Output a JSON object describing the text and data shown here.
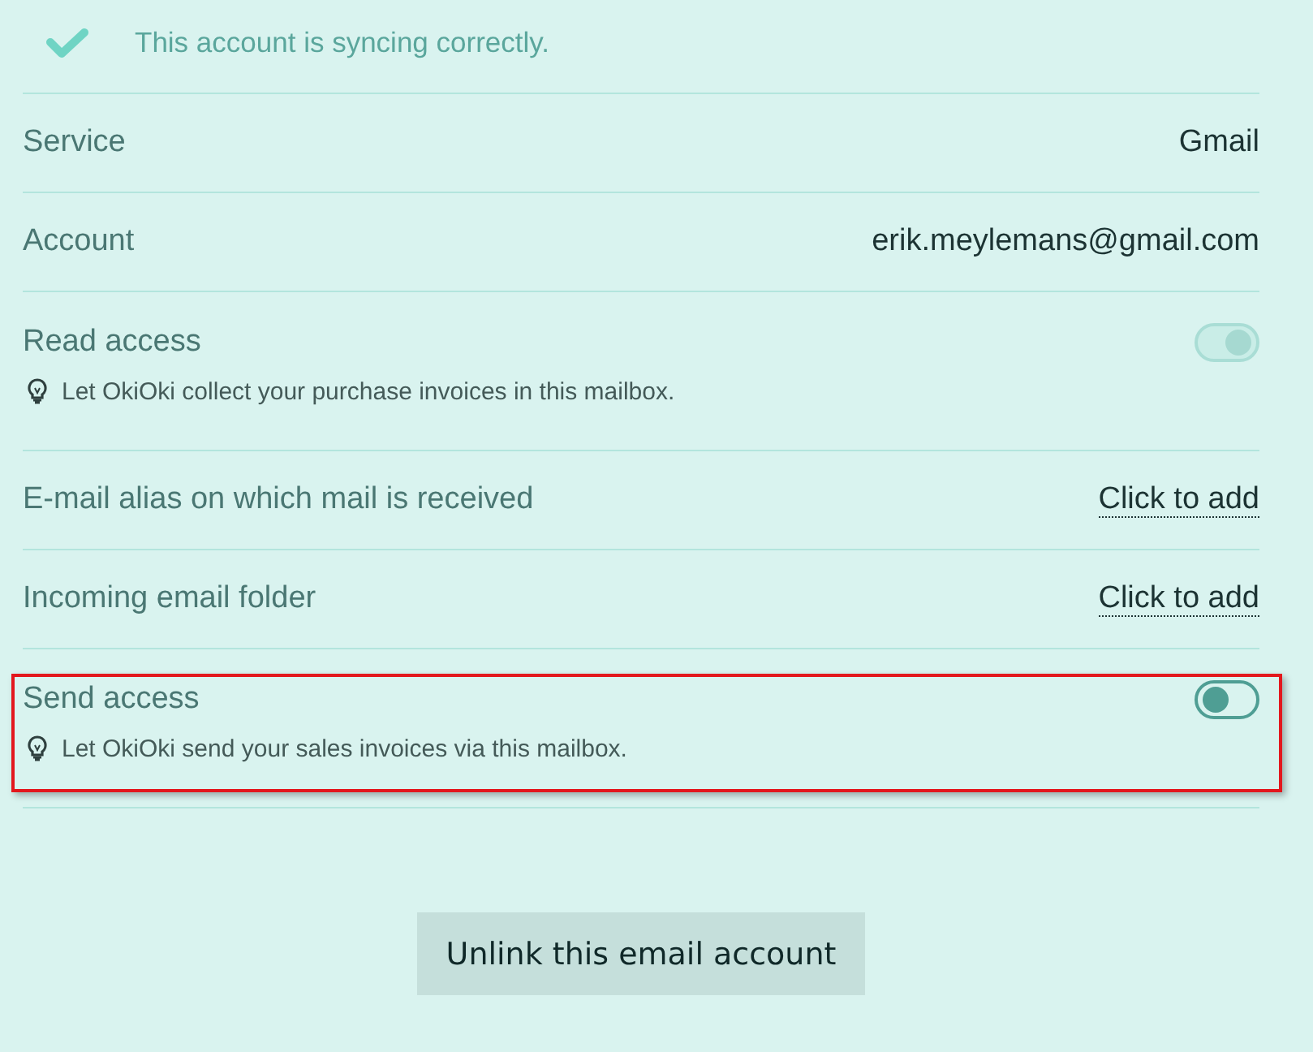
{
  "status": {
    "text": "This account is syncing correctly."
  },
  "rows": [
    {
      "kind": "value",
      "label": "Service",
      "value": "Gmail",
      "highlighted": false
    },
    {
      "kind": "value",
      "label": "Account",
      "value": "erik.meylemans@gmail.com",
      "highlighted": false
    },
    {
      "kind": "toggle",
      "label": "Read access",
      "hint": "Let OkiOki collect your purchase invoices in this mailbox.",
      "on": true,
      "disabled": true,
      "highlighted": false
    },
    {
      "kind": "link",
      "label": "E-mail alias on which mail is received",
      "value": "Click to add",
      "highlighted": false
    },
    {
      "kind": "link",
      "label": "Incoming email folder",
      "value": "Click to add",
      "highlighted": false
    },
    {
      "kind": "toggle",
      "label": "Send access",
      "hint": "Let OkiOki send your sales invoices via this mailbox.",
      "on": false,
      "disabled": false,
      "highlighted": true
    }
  ],
  "button": {
    "label": "Unlink this email account"
  }
}
